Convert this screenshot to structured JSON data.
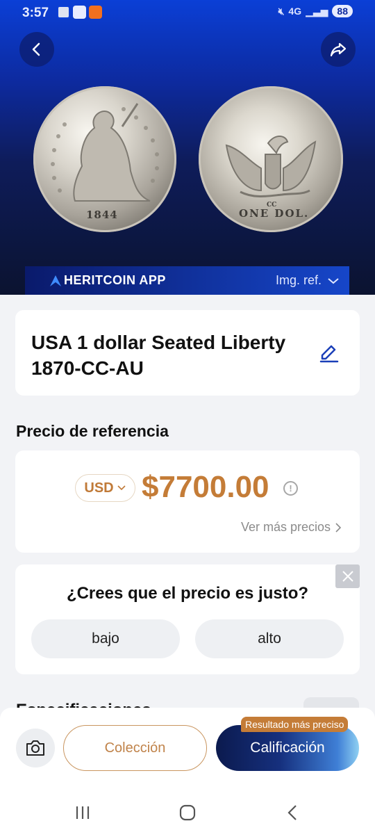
{
  "status_bar": {
    "time": "3:57",
    "network": "4G",
    "battery": "88"
  },
  "hero": {
    "coin_front_year": "1844",
    "coin_back_denomination": "ONE DOL.",
    "coin_back_mint": "CC",
    "banner_logo": "HERITCOIN APP",
    "image_ref_label": "Img. ref."
  },
  "coin": {
    "title": "USA 1 dollar  Seated Liberty 1870-CC-AU"
  },
  "price_section": {
    "title": "Precio de referencia",
    "currency": "USD",
    "price": "$7700.00",
    "more_prices": "Ver más precios"
  },
  "feedback": {
    "question": "¿Crees que el precio es justo?",
    "option_low": "bajo",
    "option_high": "alto"
  },
  "specs_peek": {
    "title": "Especificaciones"
  },
  "bottom_actions": {
    "collection_label": "Colección",
    "grade_label": "Calificación",
    "badge": "Resultado más preciso"
  },
  "colors": {
    "accent": "#c47c37",
    "hero_blue": "#0b3fd6",
    "banner_blue": "#1646c9"
  }
}
